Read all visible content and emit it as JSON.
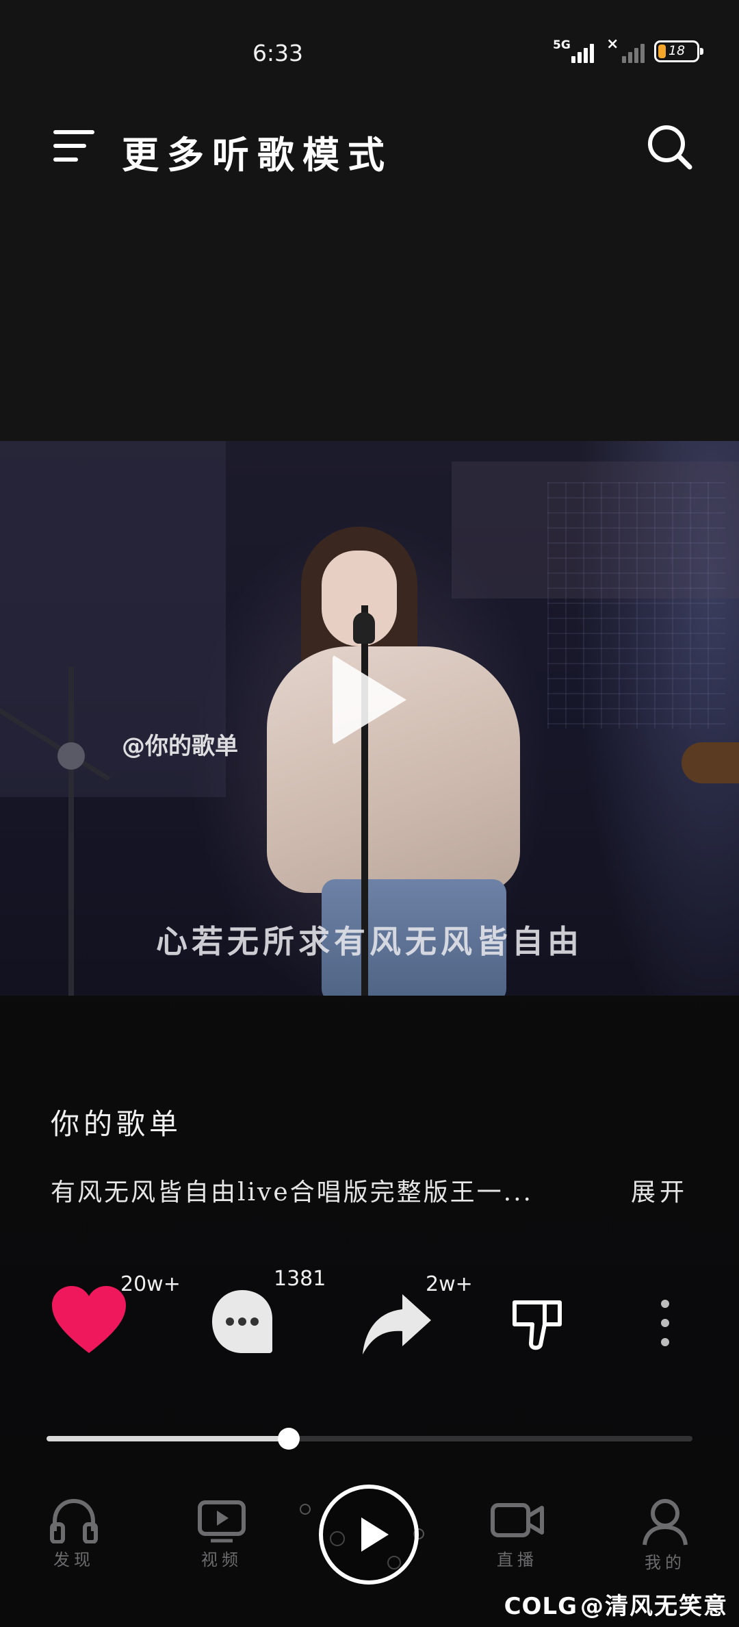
{
  "status_bar": {
    "time": "6:33",
    "network_label": "5G",
    "battery_level": "18",
    "battery_color": "#f5a52a"
  },
  "header": {
    "title": "更多听歌模式",
    "menu_icon": "hamburger-menu-icon",
    "search_icon": "search-icon"
  },
  "video": {
    "handle_watermark": "@你的歌单",
    "lyric": "心若无所求有风无风皆自由",
    "play_icon": "play-icon"
  },
  "info": {
    "playlist_name": "你的歌单",
    "description": "有风无风皆自由live合唱版完整版王一...",
    "expand_label": "展开"
  },
  "actions": {
    "like_count": "20w+",
    "comment_count": "1381",
    "share_count": "2w+",
    "like_color": "#f0185d"
  },
  "progress": {
    "played_fraction": 0.375
  },
  "bottom_nav": {
    "items": [
      {
        "label": "发现",
        "icon": "headphones-icon"
      },
      {
        "label": "视频",
        "icon": "video-play-icon"
      },
      {
        "label": "直播",
        "icon": "camera-icon"
      },
      {
        "label": "我的",
        "icon": "user-icon"
      }
    ],
    "center_icon": "play-icon"
  },
  "credit": {
    "logo": "COLG",
    "text": "@清风无笑意"
  }
}
